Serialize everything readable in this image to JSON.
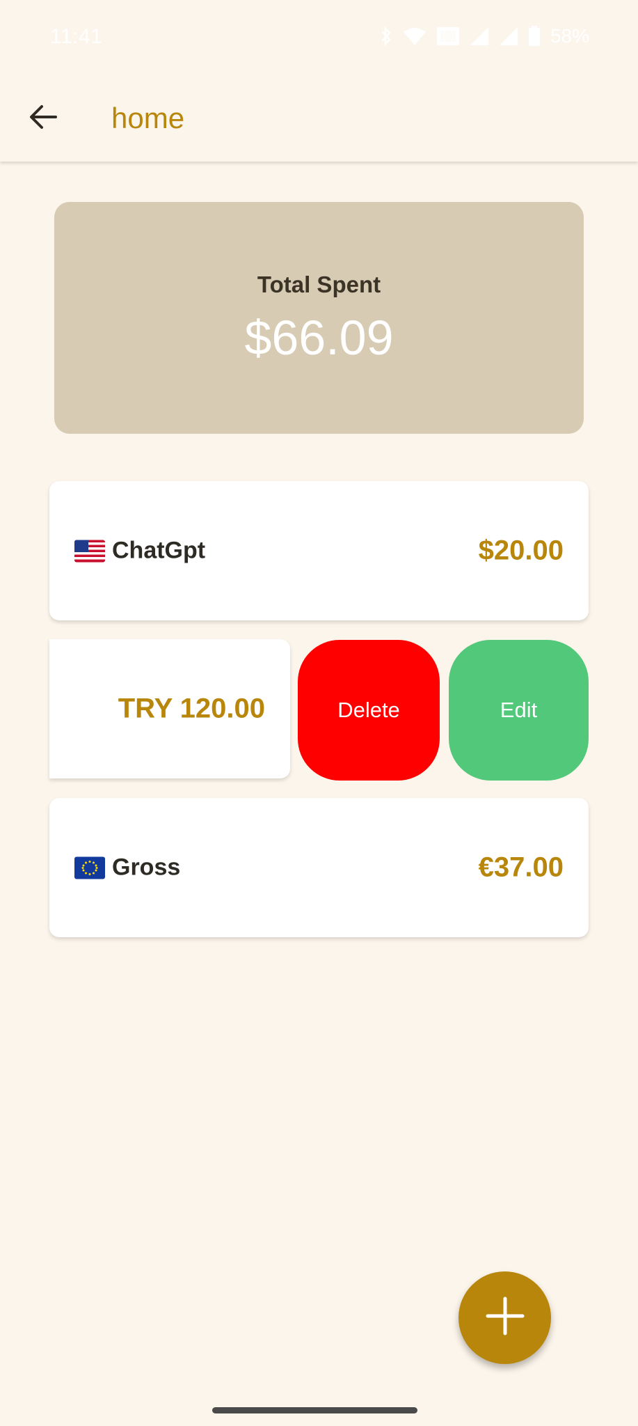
{
  "status_bar": {
    "time": "11:41",
    "battery": "58%",
    "icons": [
      "bluetooth-icon",
      "wifi-icon",
      "nfc-icon",
      "signal-icon",
      "signal-icon",
      "battery-icon"
    ]
  },
  "app_bar": {
    "back_icon": "arrow-left-icon",
    "title": "home"
  },
  "summary": {
    "label": "Total Spent",
    "value": "$66.09"
  },
  "expenses": [
    {
      "flag": "us-flag-icon",
      "name": "ChatGpt",
      "amount": "$20.00"
    },
    {
      "flag": "",
      "name": "",
      "amount": "TRY 120.00",
      "swiped": true
    },
    {
      "flag": "eu-flag-icon",
      "name": "Gross",
      "amount": "€37.00"
    }
  ],
  "swipe_actions": {
    "delete_label": "Delete",
    "edit_label": "Edit",
    "delete_color": "#ff0000",
    "edit_color": "#52c87a"
  },
  "fab": {
    "icon": "plus-icon"
  },
  "colors": {
    "background": "#fcf5eb",
    "accent": "#b8860b",
    "summary_card": "#d8cbb4"
  }
}
